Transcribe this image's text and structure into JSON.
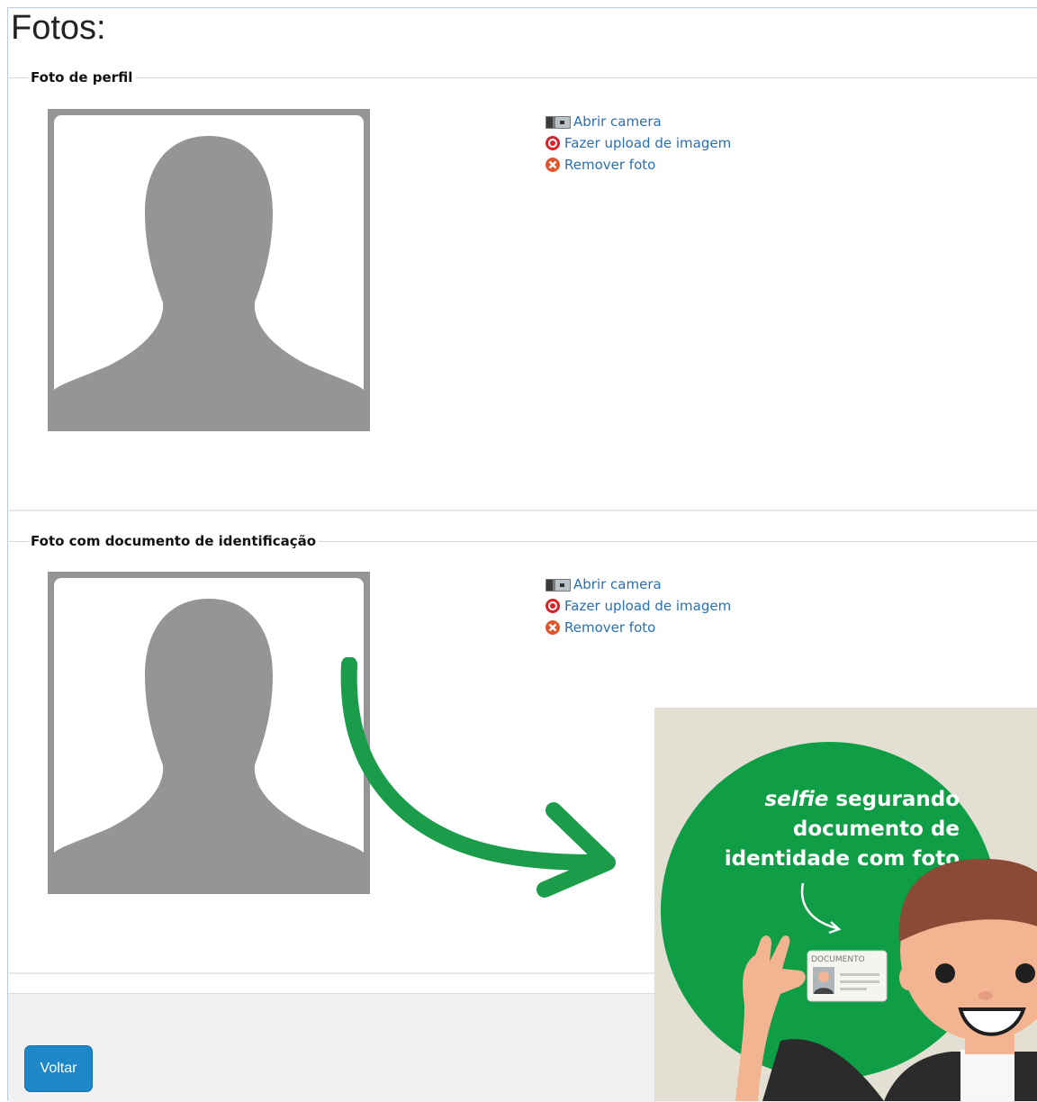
{
  "page": {
    "title": "Fotos:"
  },
  "sections": [
    {
      "legend": "Foto de perfil",
      "actions": [
        {
          "label": "Abrir camera",
          "icon": "camera-icon"
        },
        {
          "label": "Fazer upload de imagem",
          "icon": "upload-icon"
        },
        {
          "label": "Remover foto",
          "icon": "remove-icon"
        }
      ]
    },
    {
      "legend": "Foto com documento de identificação",
      "actions": [
        {
          "label": "Abrir camera",
          "icon": "camera-icon"
        },
        {
          "label": "Fazer upload de imagem",
          "icon": "upload-icon"
        },
        {
          "label": "Remover foto",
          "icon": "remove-icon"
        }
      ]
    }
  ],
  "footer": {
    "back_button": "Voltar"
  },
  "promo": {
    "line1_italic": "selfie",
    "line1_rest": " segurando",
    "line2": "documento de",
    "line3": "identidade com foto",
    "card_label": "DOCUMENTO"
  },
  "colors": {
    "link": "#2a6fb0",
    "button": "#1e87c9",
    "promo_green": "#0f9d45",
    "arrow_green": "#1b9c4a",
    "avatar_bg": "#959595"
  }
}
